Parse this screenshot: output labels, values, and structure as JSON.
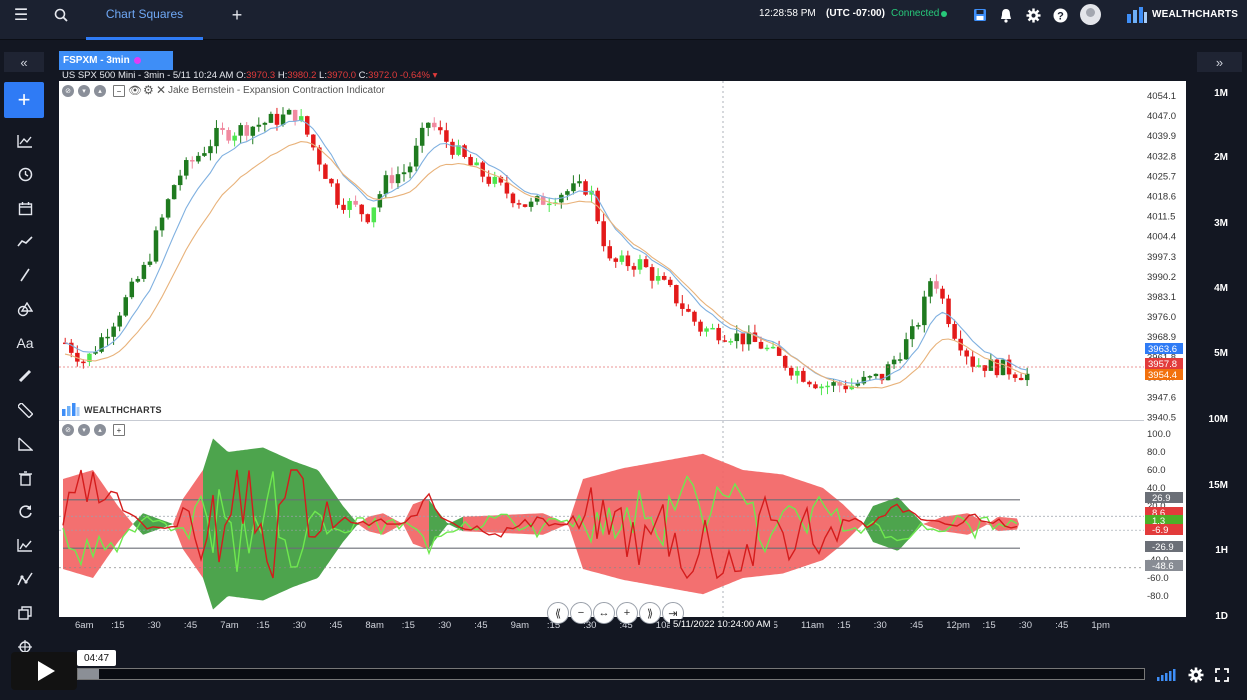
{
  "topbar": {
    "menu_icon": "hamburger-icon",
    "search_icon": "search-icon",
    "tab_label": "Chart Squares",
    "add_tab_icon": "plus-icon",
    "clock": "12:28:58 PM",
    "timezone": "(UTC -07:00)",
    "connection": "Connected",
    "brand": "WEALTHCHARTS"
  },
  "leftbar": {
    "collapse": "«",
    "add": "+",
    "tools": [
      "chart-type-icon",
      "clock-icon",
      "calendar-icon",
      "trend-icon",
      "line-icon",
      "shapes-icon",
      "text-icon",
      "pencil-icon",
      "ruler-icon",
      "triangle-icon",
      "trash-icon",
      "refresh-icon",
      "indicator-icon",
      "pattern-icon",
      "copy-icon",
      "target-icon"
    ]
  },
  "rightbar": {
    "collapse": "»",
    "intervals": [
      "1M",
      "2M",
      "3M",
      "4M",
      "5M",
      "10M",
      "15M",
      "1H",
      "1D"
    ]
  },
  "chart": {
    "tab_label": "FSPXM - 3min",
    "symbol": "US SPX 500 Mini",
    "meta": "- 3min - 5/11 10:24 AM",
    "o_label": "O:",
    "o_val": "3970.3",
    "h_label": "H:",
    "h_val": "3980.2",
    "l_label": "L:",
    "l_val": "3970.0",
    "c_label": "C:",
    "c_val": "3972.0",
    "change": "-0.64%",
    "indicator_label": "Jake Bernstein - Expansion Contraction Indicator",
    "watermark": "WEALTHCHARTS",
    "crosshair_date": "5/11/2022 10:24:00 AM"
  },
  "price_axis": {
    "ticks": [
      "4054.1",
      "4047.0",
      "4039.9",
      "4032.8",
      "4025.7",
      "4018.6",
      "4011.5",
      "4004.4",
      "3997.3",
      "3990.2",
      "3983.1",
      "3976.0",
      "3968.9",
      "3961.8",
      "3954.7",
      "3947.6",
      "3940.5"
    ],
    "labels": [
      {
        "text": "3963.6",
        "color": "#2f7bf5"
      },
      {
        "text": "3957.8",
        "color": "#e23b3b"
      },
      {
        "text": "3954.4",
        "color": "#f2700c"
      }
    ]
  },
  "indicator_axis": {
    "ticks": [
      "100.0",
      "80.0",
      "60.0",
      "40.0",
      "20.0",
      "-40.0",
      "-60.0",
      "-80.0"
    ],
    "labels": [
      {
        "text": "26.9",
        "color": "#6b6f77"
      },
      {
        "text": "8.6",
        "color": "#e23b3b"
      },
      {
        "text": "1.3",
        "color": "#4caf28"
      },
      {
        "text": "-6.9",
        "color": "#e23b3b"
      },
      {
        "text": "-26.9",
        "color": "#6b6f77"
      },
      {
        "text": "-48.6",
        "color": "#888c94"
      }
    ]
  },
  "time_axis": [
    "6am",
    ":15",
    ":30",
    ":45",
    "7am",
    ":15",
    ":30",
    ":45",
    "8am",
    ":15",
    ":30",
    ":45",
    "9am",
    ":15",
    ":30",
    ":45",
    "10am",
    ":15",
    ":30",
    ":45",
    "11am",
    ":15",
    ":30",
    ":45",
    "12pm",
    ":15",
    ":30",
    ":45",
    "1pm"
  ],
  "navigation": [
    "⟪",
    "−",
    "↔",
    "+",
    "⟫",
    "⇥"
  ],
  "player": {
    "time": "04:47",
    "progress": 0.02,
    "icons": [
      "play-icon",
      "volume-icon",
      "settings-icon",
      "fullscreen-icon"
    ]
  },
  "colors": {
    "bull": "#1f7a1f",
    "bull_light": "#4ee64e",
    "bear": "#e31a1a",
    "bear_light": "#f08aa0",
    "ema_fast": "#7fb0e0",
    "ema_slow": "#e8b27a",
    "band_red": "#f26464",
    "band_green": "#3e9c3e",
    "line_red": "#d41c1c",
    "line_green": "#6fe84f"
  }
}
